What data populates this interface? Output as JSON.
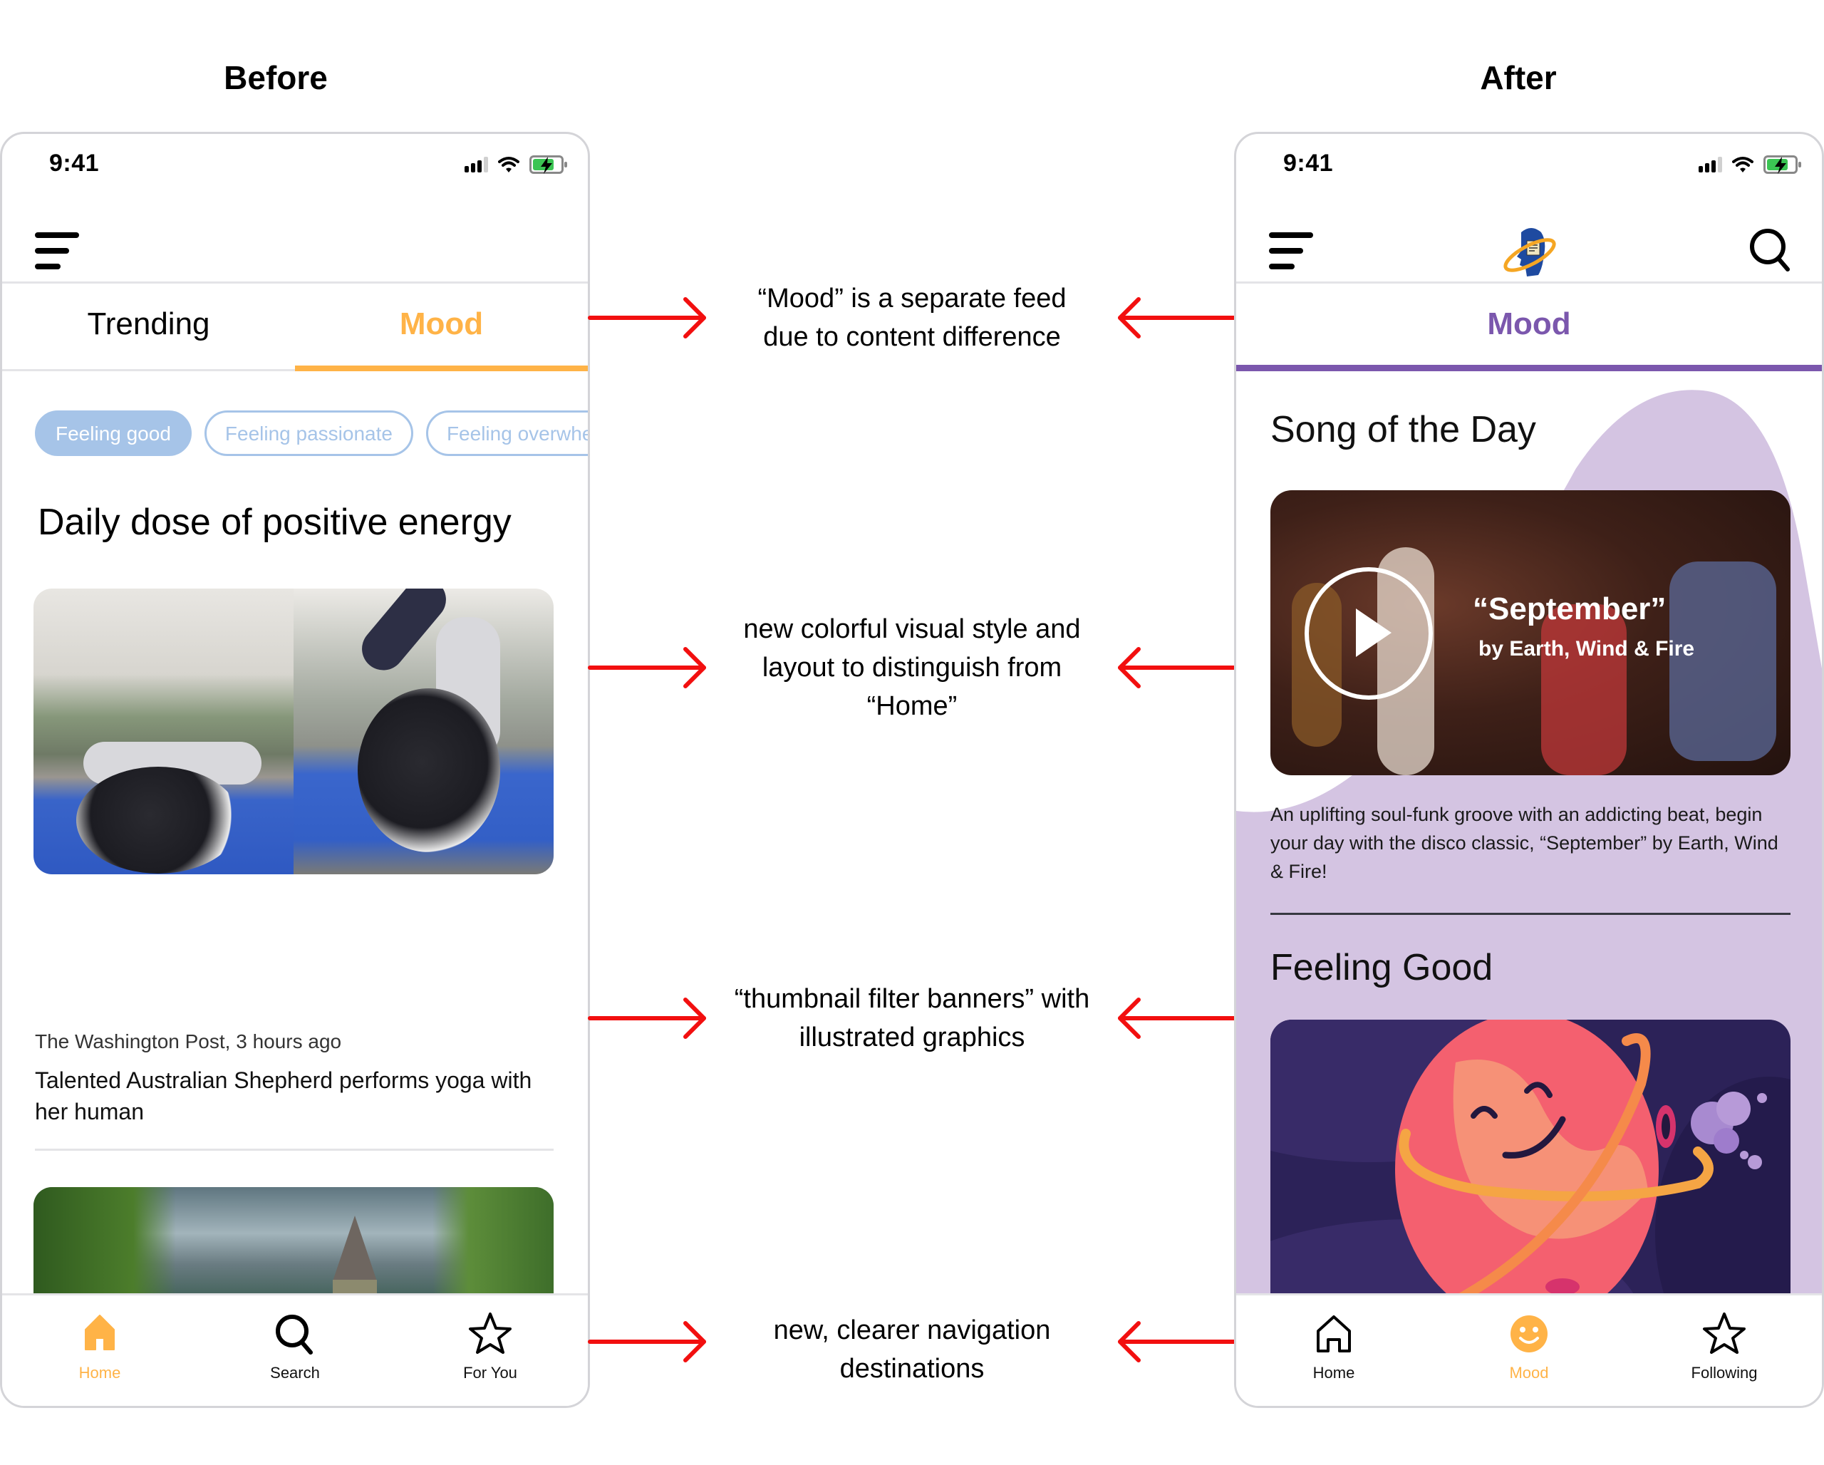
{
  "labels": {
    "before": "Before",
    "after": "After"
  },
  "colors": {
    "before_accent": "#ffb347",
    "after_accent": "#7b57ad",
    "chip_blue": "#a6c4e8",
    "lavender": "#d4c4e2",
    "arrow_red": "#f20f0f"
  },
  "before": {
    "status_time": "9:41",
    "tabs": [
      {
        "label": "Trending",
        "active": false
      },
      {
        "label": "Mood",
        "active": true
      }
    ],
    "chips": [
      {
        "label": "Feeling good",
        "active": true
      },
      {
        "label": "Feeling passionate",
        "active": false
      },
      {
        "label": "Feeling overwhelm",
        "active": false
      }
    ],
    "heading": "Daily dose of positive energy",
    "article": {
      "source": "The Washington Post, 3 hours ago",
      "title": "Talented Australian Shepherd performs yoga with her human"
    },
    "nav": [
      {
        "label": "Home",
        "icon": "home-filled-icon",
        "active": true
      },
      {
        "label": "Search",
        "icon": "search-icon",
        "active": false
      },
      {
        "label": "For You",
        "icon": "star-icon",
        "active": false
      }
    ]
  },
  "after": {
    "status_time": "9:41",
    "tab": {
      "label": "Mood",
      "active": true
    },
    "song_section": {
      "heading": "Song of the Day",
      "song_title": "“September”",
      "artist": "by Earth, Wind & Fire",
      "description": "An uplifting soul-funk groove with an addicting beat, begin your day with the disco classic, “September” by Earth, Wind & Fire!"
    },
    "feeling_section": {
      "heading": "Feeling Good"
    },
    "nav": [
      {
        "label": "Home",
        "icon": "home-outline-icon",
        "active": false
      },
      {
        "label": "Mood",
        "icon": "smiley-icon",
        "active": true
      },
      {
        "label": "Following",
        "icon": "star-icon",
        "active": false
      }
    ]
  },
  "annotations": [
    {
      "text": "“Mood” is a separate feed due to content difference"
    },
    {
      "text": "new colorful visual style and layout to distinguish from “Home”"
    },
    {
      "text": "“thumbnail filter banners” with illustrated graphics"
    },
    {
      "text": "new, clearer navigation destinations"
    }
  ]
}
